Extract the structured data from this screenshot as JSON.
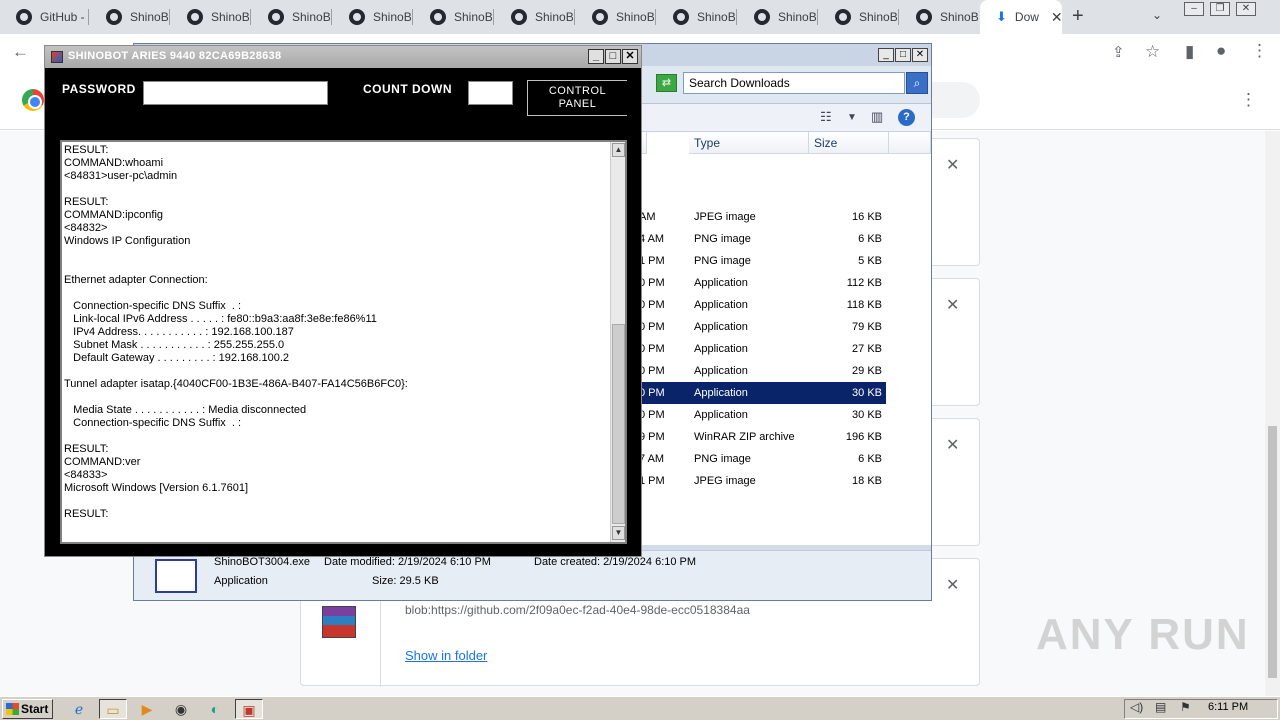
{
  "browser": {
    "tabs": [
      {
        "label": "GitHub -"
      },
      {
        "label": "ShinoBO"
      },
      {
        "label": "ShinoBO"
      },
      {
        "label": "ShinoBO"
      },
      {
        "label": "ShinoBO"
      },
      {
        "label": "ShinoBO"
      },
      {
        "label": "ShinoBO"
      },
      {
        "label": "ShinoBO"
      },
      {
        "label": "ShinoBO"
      },
      {
        "label": "ShinoBO"
      },
      {
        "label": "ShinoBO"
      },
      {
        "label": "ShinoBO"
      }
    ],
    "active_tab": {
      "label": "Dow"
    }
  },
  "explorer": {
    "search_placeholder": "Search Downloads",
    "columns": {
      "type": "Type",
      "size": "Size"
    },
    "files": [
      {
        "time": "AM",
        "type": "JPEG image",
        "size": "16 KB"
      },
      {
        "time": "4 AM",
        "type": "PNG image",
        "size": "6 KB"
      },
      {
        "time": "1 PM",
        "type": "PNG image",
        "size": "5 KB"
      },
      {
        "time": "0 PM",
        "type": "Application",
        "size": "112 KB"
      },
      {
        "time": "0 PM",
        "type": "Application",
        "size": "118 KB"
      },
      {
        "time": "0 PM",
        "type": "Application",
        "size": "79 KB"
      },
      {
        "time": "0 PM",
        "type": "Application",
        "size": "27 KB"
      },
      {
        "time": "0 PM",
        "type": "Application",
        "size": "29 KB"
      },
      {
        "time": "0 PM",
        "type": "Application",
        "size": "30 KB",
        "selected": true
      },
      {
        "time": "0 PM",
        "type": "Application",
        "size": "30 KB"
      },
      {
        "time": "9 PM",
        "type": "WinRAR ZIP archive",
        "size": "196 KB"
      },
      {
        "time": "7 AM",
        "type": "PNG image",
        "size": "6 KB"
      },
      {
        "time": "1 PM",
        "type": "JPEG image",
        "size": "18 KB"
      }
    ],
    "details": {
      "name": "ShinoBOT3004.exe",
      "modified": "Date modified: 2/19/2024 6:10 PM",
      "created": "Date created: 2/19/2024 6:10 PM",
      "kind": "Application",
      "size": "Size: 29.5 KB"
    }
  },
  "shinobot": {
    "title": "SHINOBOT ARIES 9440 82CA69B28638",
    "password_label": "PASSWORD",
    "countdown_label": "COUNT DOWN",
    "control_panel_label": "CONTROL\nPANEL",
    "console_output": "RESULT:\nCOMMAND:whoami\n<84831>user-pc\\admin\n\nRESULT:\nCOMMAND:ipconfig\n<84832>\nWindows IP Configuration\n\n\nEthernet adapter Connection:\n\n   Connection-specific DNS Suffix  . :\n   Link-local IPv6 Address . . . . . : fe80::b9a3:aa8f:3e8e:fe86%11\n   IPv4 Address. . . . . . . . . . . : 192.168.100.187\n   Subnet Mask . . . . . . . . . . . : 255.255.255.0\n   Default Gateway . . . . . . . . . : 192.168.100.2\n\nTunnel adapter isatap.{4040CF00-1B3E-486A-B407-FA14C56B6FC0}:\n\n   Media State . . . . . . . . . . . : Media disconnected\n   Connection-specific DNS Suffix  . :\n\nRESULT:\nCOMMAND:ver\n<84833>\nMicrosoft Windows [Version 6.1.7601]\n\nRESULT:"
  },
  "downloads_page": {
    "blob_url": "blob:https://github.com/2f09a0ec-f2ad-40e4-98de-ecc0518384aa",
    "show_in_folder": "Show in folder",
    "watermark": "ANY RUN"
  },
  "taskbar": {
    "start_label": "Start",
    "clock": "6:11 PM"
  }
}
